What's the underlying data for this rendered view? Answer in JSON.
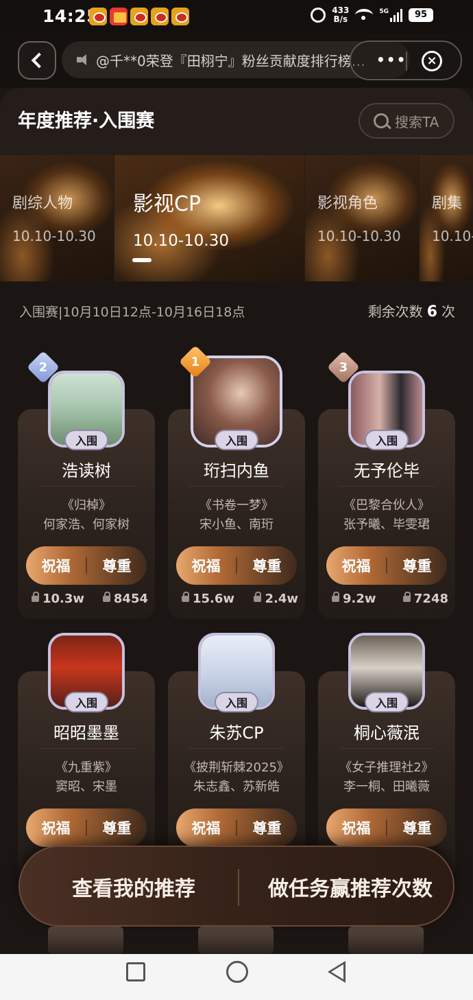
{
  "status": {
    "time": "14:25",
    "net_speed_top": "433",
    "net_speed_bottom": "B/s",
    "network": "5G",
    "battery": "95"
  },
  "topbar": {
    "ticker": "@千**0荣登『田栩宁』粉丝贡献度排行榜…"
  },
  "header": {
    "title": "年度推荐·入围赛",
    "search_label": "搜索TA"
  },
  "tabs": [
    {
      "name": "剧综人物",
      "date": "10.10-10.30"
    },
    {
      "name": "影视CP",
      "date": "10.10-10.30"
    },
    {
      "name": "影视角色",
      "date": "10.10-10.30"
    },
    {
      "name": "剧集",
      "date": "10.10-"
    }
  ],
  "meta": {
    "schedule": "入围赛|10月10日12点-10月16日18点",
    "remain_prefix": "剩余次数",
    "remain_count": "6",
    "remain_suffix": "次"
  },
  "cards": [
    {
      "rank": "2",
      "tag": "入围",
      "name": "浩读树",
      "work": "《归棹》",
      "people": "何家浩、何家树",
      "bless": "祝福",
      "respect": "尊重",
      "stat1": "10.3w",
      "stat2": "8454"
    },
    {
      "rank": "1",
      "tag": "入围",
      "name": "珩扫内鱼",
      "work": "《书卷一梦》",
      "people": "宋小鱼、南珩",
      "bless": "祝福",
      "respect": "尊重",
      "stat1": "15.6w",
      "stat2": "2.4w"
    },
    {
      "rank": "3",
      "tag": "入围",
      "name": "无予伦毕",
      "work": "《巴黎合伙人》",
      "people": "张予曦、毕雯珺",
      "bless": "祝福",
      "respect": "尊重",
      "stat1": "9.2w",
      "stat2": "7248"
    },
    {
      "tag": "入围",
      "name": "昭昭墨墨",
      "work": "《九重紫》",
      "people": "窦昭、宋墨",
      "bless": "祝福",
      "respect": "尊重"
    },
    {
      "tag": "入围",
      "name": "朱苏CP",
      "work": "《披荆斩棘2025》",
      "people": "朱志鑫、苏新皓",
      "bless": "祝福",
      "respect": "尊重"
    },
    {
      "tag": "入围",
      "name": "桐心薇泯",
      "work": "《女子推理社2》",
      "people": "李一桐、田曦薇",
      "bless": "祝福",
      "respect": "尊重"
    }
  ],
  "actions": {
    "my_recommend": "查看我的推荐",
    "earn_tasks": "做任务赢推荐次数"
  }
}
